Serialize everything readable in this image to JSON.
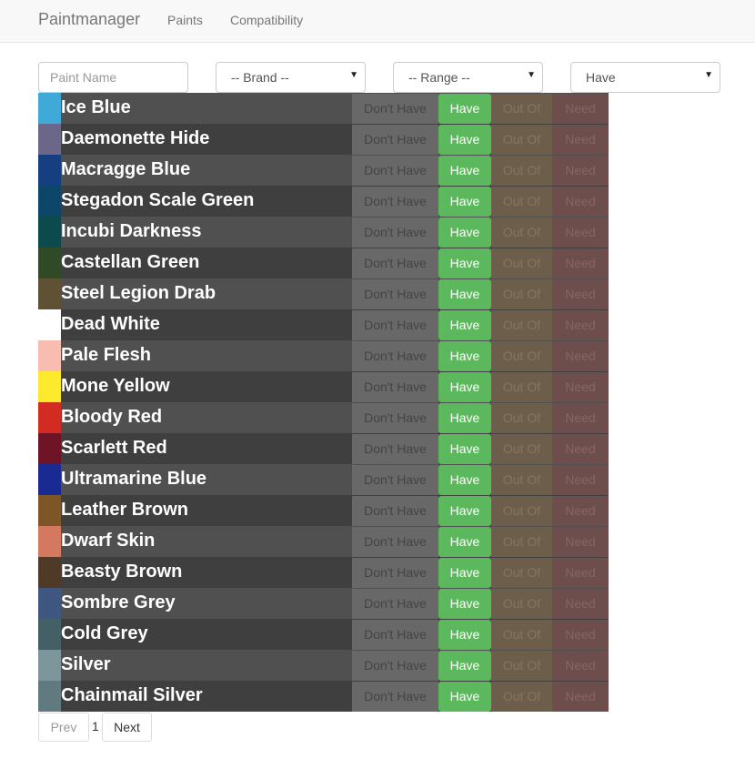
{
  "navbar": {
    "brand": "Paintmanager",
    "links": [
      "Paints",
      "Compatibility"
    ]
  },
  "filters": {
    "name_placeholder": "Paint Name",
    "brand": "-- Brand --",
    "range": "-- Range --",
    "status": "Have"
  },
  "status_labels": {
    "dont_have": "Don't Have",
    "have": "Have",
    "out_of": "Out Of",
    "need": "Need"
  },
  "paints": [
    {
      "name": "Ice Blue",
      "color": "#3fa9d7"
    },
    {
      "name": "Daemonette Hide",
      "color": "#6b6789"
    },
    {
      "name": "Macragge Blue",
      "color": "#163f82"
    },
    {
      "name": "Stegadon Scale Green",
      "color": "#0c4668"
    },
    {
      "name": "Incubi Darkness",
      "color": "#0c4a4d"
    },
    {
      "name": "Castellan Green",
      "color": "#304a28"
    },
    {
      "name": "Steel Legion Drab",
      "color": "#5e5134"
    },
    {
      "name": "Dead White",
      "color": "#ffffff"
    },
    {
      "name": "Pale Flesh",
      "color": "#f8bcb0"
    },
    {
      "name": "Mone Yellow",
      "color": "#fde92d"
    },
    {
      "name": "Bloody Red",
      "color": "#d22b22"
    },
    {
      "name": "Scarlett Red",
      "color": "#6f1426"
    },
    {
      "name": "Ultramarine Blue",
      "color": "#192a92"
    },
    {
      "name": "Leather Brown",
      "color": "#7d5627"
    },
    {
      "name": "Dwarf Skin",
      "color": "#d4785f"
    },
    {
      "name": "Beasty Brown",
      "color": "#4e3a26"
    },
    {
      "name": "Sombre Grey",
      "color": "#3f5680"
    },
    {
      "name": "Cold Grey",
      "color": "#445f66"
    },
    {
      "name": "Silver",
      "color": "#7d969c"
    },
    {
      "name": "Chainmail Silver",
      "color": "#617a7f"
    }
  ],
  "pagination": {
    "prev": "Prev",
    "page": "1",
    "next": "Next"
  }
}
